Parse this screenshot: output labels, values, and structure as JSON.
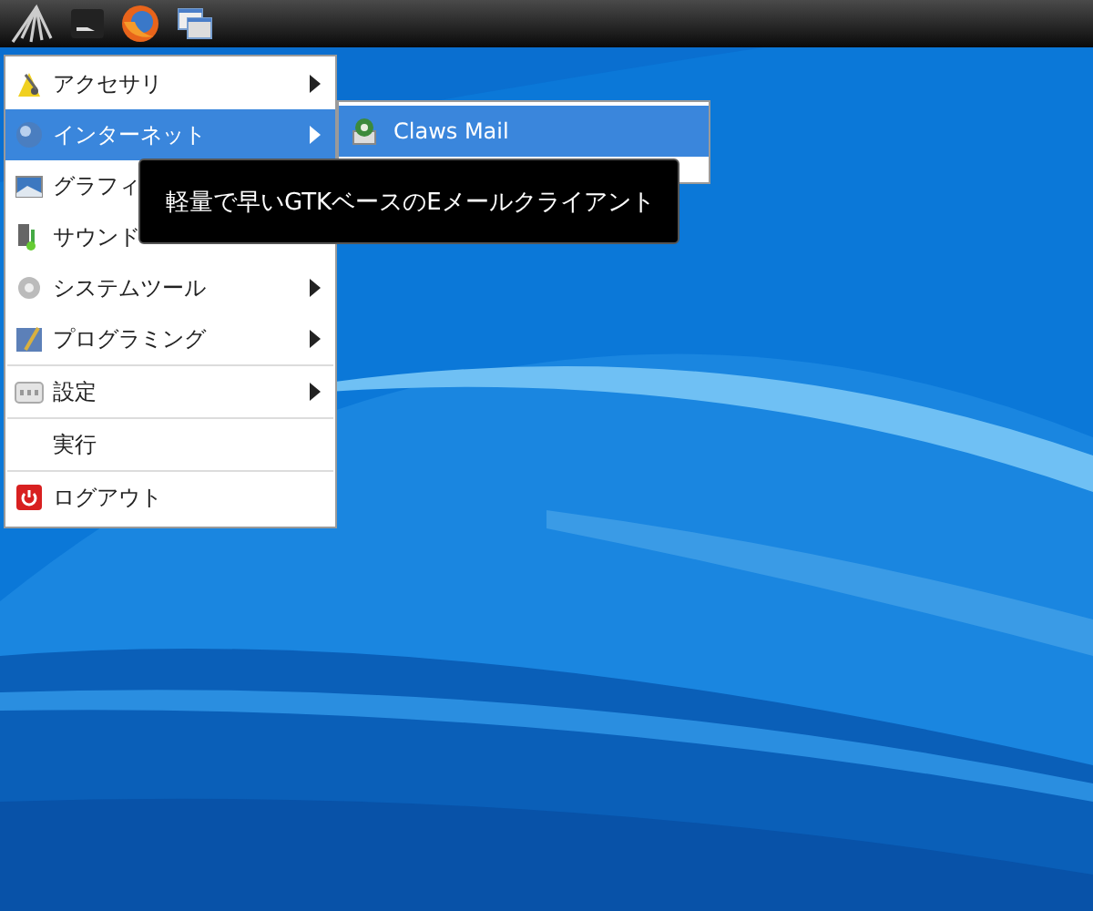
{
  "menu": {
    "items": [
      {
        "label": "アクセサリ",
        "has_submenu": true,
        "selected": false,
        "separator_after": false
      },
      {
        "label": "インターネット",
        "has_submenu": true,
        "selected": true,
        "separator_after": false
      },
      {
        "label": "グラフィ",
        "has_submenu": false,
        "selected": false,
        "separator_after": false
      },
      {
        "label": "サウンド",
        "has_submenu": false,
        "selected": false,
        "separator_after": false
      },
      {
        "label": "システムツール",
        "has_submenu": true,
        "selected": false,
        "separator_after": false
      },
      {
        "label": "プログラミング",
        "has_submenu": true,
        "selected": false,
        "separator_after": true
      },
      {
        "label": "設定",
        "has_submenu": true,
        "selected": false,
        "separator_after": true
      },
      {
        "label": "実行",
        "has_submenu": false,
        "selected": false,
        "separator_after": true
      },
      {
        "label": "ログアウト",
        "has_submenu": false,
        "selected": false,
        "separator_after": false
      }
    ]
  },
  "submenu": {
    "items": [
      {
        "label": "Claws Mail",
        "selected": true
      }
    ]
  },
  "tooltip": {
    "text": "軽量で早いGTKベースのEメールクライアント"
  }
}
